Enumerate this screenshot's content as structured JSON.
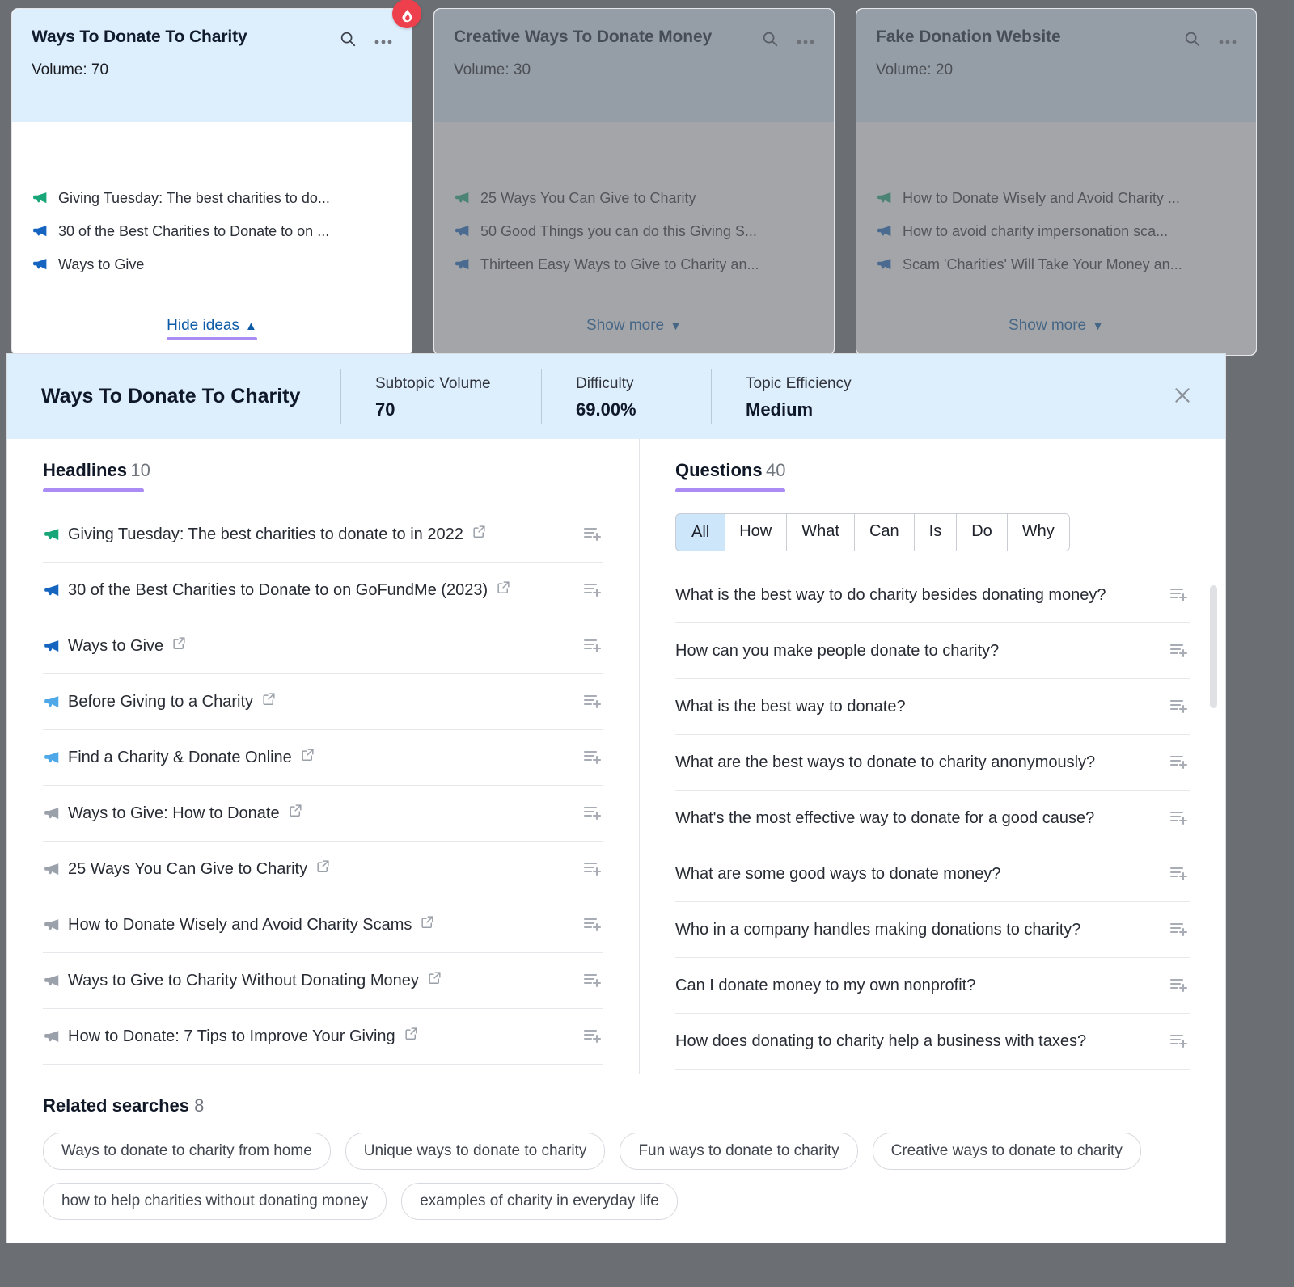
{
  "cards": [
    {
      "title": "Ways To Donate To Charity",
      "volume_label": "Volume: 70",
      "ideas": [
        {
          "text": "Giving Tuesday: The best charities to do...",
          "color": "#18a578"
        },
        {
          "text": "30 of the Best Charities to Donate to on ...",
          "color": "#1565c0"
        },
        {
          "text": "Ways to Give",
          "color": "#1565c0"
        }
      ],
      "toggle_label": "Hide ideas",
      "toggle_dir": "up",
      "active": true,
      "badge": "fire-icon"
    },
    {
      "title": "Creative Ways To Donate Money",
      "volume_label": "Volume: 30",
      "ideas": [
        {
          "text": "25 Ways You Can Give to Charity",
          "color": "#18a578"
        },
        {
          "text": "50 Good Things you can do this Giving S...",
          "color": "#1565c0"
        },
        {
          "text": "Thirteen Easy Ways to Give to Charity an...",
          "color": "#1565c0"
        }
      ],
      "toggle_label": "Show more",
      "toggle_dir": "down",
      "active": false,
      "badge": ""
    },
    {
      "title": "Fake Donation Website",
      "volume_label": "Volume: 20",
      "ideas": [
        {
          "text": "How to Donate Wisely and Avoid Charity ...",
          "color": "#18a578"
        },
        {
          "text": "How to avoid charity impersonation sca...",
          "color": "#1565c0"
        },
        {
          "text": "Scam 'Charities' Will Take Your Money an...",
          "color": "#1565c0"
        }
      ],
      "toggle_label": "Show more",
      "toggle_dir": "down",
      "active": false,
      "badge": ""
    }
  ],
  "panel": {
    "title": "Ways To Donate To Charity",
    "metrics": [
      {
        "label": "Subtopic Volume",
        "value": "70"
      },
      {
        "label": "Difficulty",
        "value": "69.00%"
      },
      {
        "label": "Topic Efficiency",
        "value": "Medium"
      }
    ],
    "close_icon": "close-icon"
  },
  "headlines": {
    "title": "Headlines",
    "count": "10",
    "items": [
      {
        "text": "Giving Tuesday: The best charities to donate to in 2022",
        "color": "#18a578",
        "external": true
      },
      {
        "text": "30 of the Best Charities to Donate to on GoFundMe (2023)",
        "color": "#1565c0",
        "external": true
      },
      {
        "text": "Ways to Give",
        "color": "#1565c0",
        "external": true
      },
      {
        "text": "Before Giving to a Charity",
        "color": "#4ea8e8",
        "external": true
      },
      {
        "text": "Find a Charity & Donate Online",
        "color": "#4ea8e8",
        "external": true
      },
      {
        "text": "Ways to Give: How to Donate",
        "color": "#9ba1ab",
        "external": true
      },
      {
        "text": "25 Ways You Can Give to Charity",
        "color": "#9ba1ab",
        "external": true
      },
      {
        "text": "How to Donate Wisely and Avoid Charity Scams",
        "color": "#9ba1ab",
        "external": true
      },
      {
        "text": "Ways to Give to Charity Without Donating Money",
        "color": "#9ba1ab",
        "external": true
      },
      {
        "text": "How to Donate: 7 Tips to Improve Your Giving",
        "color": "#9ba1ab",
        "external": true
      }
    ]
  },
  "questions": {
    "title": "Questions",
    "count": "40",
    "filters": [
      "All",
      "How",
      "What",
      "Can",
      "Is",
      "Do",
      "Why"
    ],
    "selected_filter": "All",
    "items": [
      "What is the best way to do charity besides donating money?",
      "How can you make people donate to charity?",
      "What is the best way to donate?",
      "What are the best ways to donate to charity anonymously?",
      "What's the most effective way to donate for a good cause?",
      "What are some good ways to donate money?",
      "Who in a company handles making donations to charity?",
      "Can I donate money to my own nonprofit?",
      "How does donating to charity help a business with taxes?"
    ]
  },
  "related": {
    "title": "Related searches",
    "count": "8",
    "chips": [
      "Ways to donate to charity from home",
      "Unique ways to donate to charity",
      "Fun ways to donate to charity",
      "Creative ways to donate to charity",
      "how to help charities without donating money",
      "examples of charity in everyday life"
    ]
  },
  "icons": {
    "search": "search-icon",
    "more": "more-options-icon",
    "add_to_list": "add-to-list-icon",
    "external_link": "external-link-icon"
  },
  "colors": {
    "accent_purple": "#ab8cf5",
    "header_blue": "#ddeefc",
    "link_blue": "#0d5aa7",
    "badge_red": "#ee3f4c"
  }
}
